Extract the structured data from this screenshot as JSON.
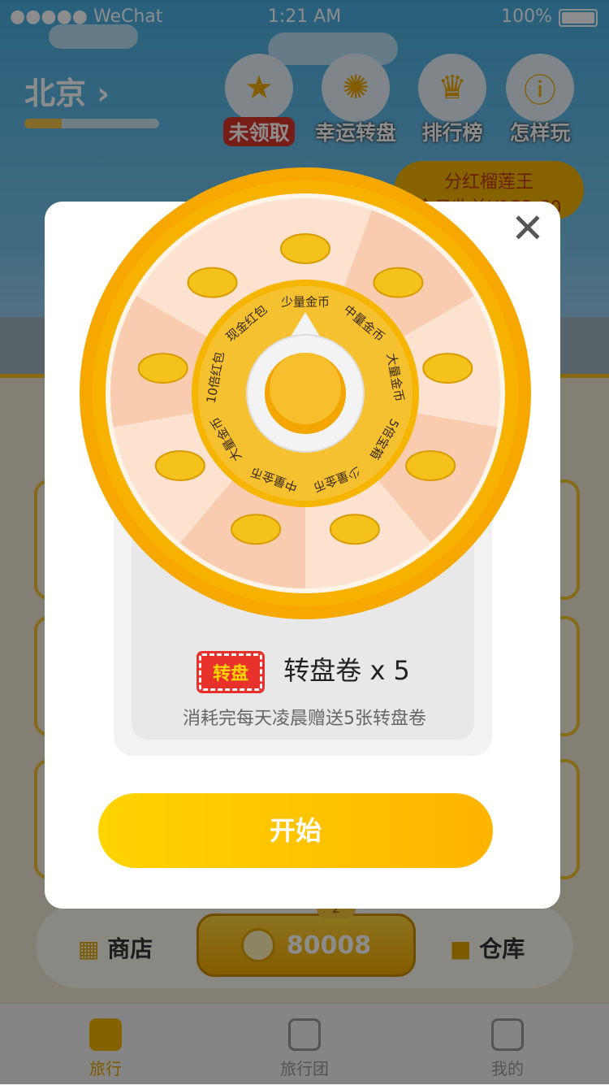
{
  "status_bar": {
    "carrier": "●●●●● WeChat",
    "time": "1:21 AM",
    "battery": "100%"
  },
  "header": {
    "city": "北京 ›",
    "city_progress": 0.28,
    "buttons": [
      {
        "label": "未领取",
        "icon": "coin-icon"
      },
      {
        "label": "幸运转盘",
        "icon": "wheel-icon"
      },
      {
        "label": "排行榜",
        "icon": "trophy-icon"
      },
      {
        "label": "怎样玩",
        "icon": "info-icon"
      }
    ],
    "promo": {
      "line1": "分红榴莲王",
      "line2": "今日收益¥152.60"
    }
  },
  "wheel": {
    "segments": [
      "少量金币",
      "中量金币",
      "大量金币",
      "5倍宝箱",
      "少量金币",
      "中量金币",
      "大量金币",
      "10倍红包",
      "现金红包"
    ],
    "colors": {
      "light": "#fde2cf",
      "dark": "#f9ccb0",
      "rim": "#f7b200",
      "hub": "#f6c131"
    }
  },
  "ticket": {
    "badge": "转盘",
    "label": "转盘卷 x 5",
    "note": "消耗完每天凌晨赠送5张转盘卷"
  },
  "start_button": "开始",
  "bottom_bar": {
    "shop": "商店",
    "coins": "80008",
    "badge": "2",
    "warehouse": "仓库"
  },
  "tabbar": {
    "tabs": [
      "旅行",
      "旅行团",
      "我的"
    ]
  }
}
